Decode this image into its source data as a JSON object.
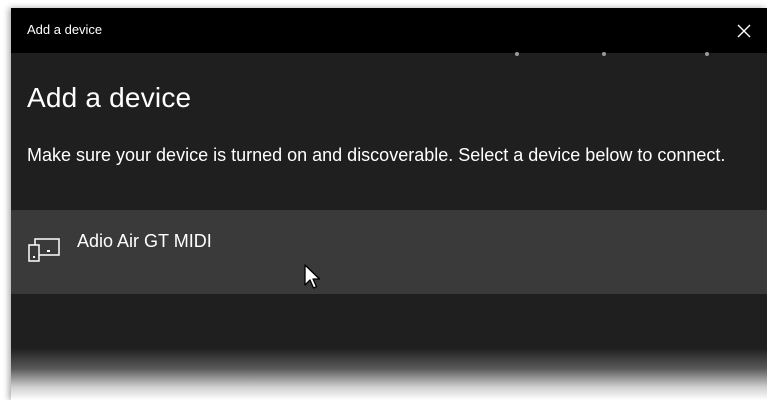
{
  "window": {
    "title": "Add a device",
    "close_icon": "close-icon"
  },
  "main": {
    "heading": "Add a device",
    "instructions": "Make sure your device is turned on and discoverable. Select a device below to connect."
  },
  "devices": [
    {
      "name": "Adio Air GT MIDI",
      "icon": "device-icon"
    }
  ],
  "colors": {
    "titlebar_bg": "#000000",
    "body_bg": "#1f1f1f",
    "row_hover_bg": "#3a3a3a",
    "text": "#ffffff"
  }
}
